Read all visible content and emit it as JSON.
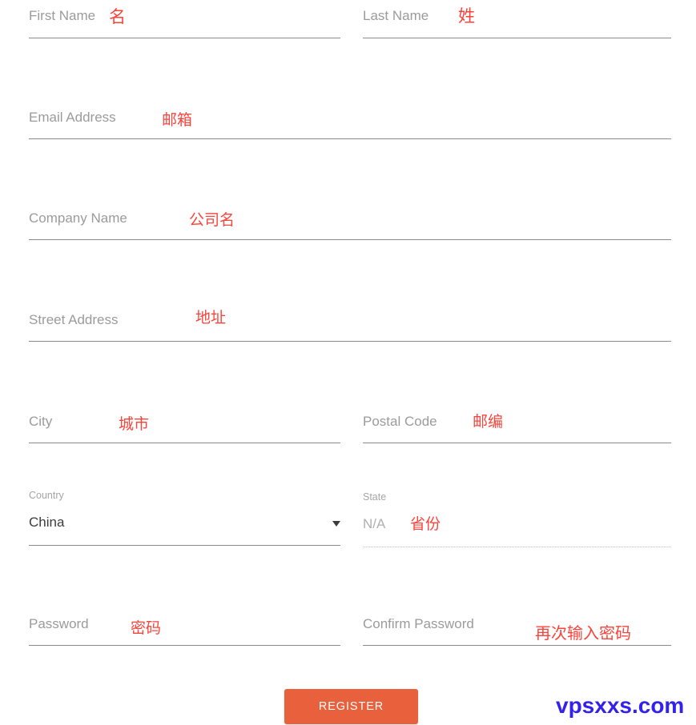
{
  "form": {
    "fields": [
      {
        "name": "first-name",
        "label": "First Name",
        "annotation": "名",
        "value": "",
        "placeholder": ""
      },
      {
        "name": "last-name",
        "label": "Last Name",
        "annotation": "姓",
        "value": "",
        "placeholder": ""
      },
      {
        "name": "email-address",
        "label": "Email Address",
        "annotation": "邮箱",
        "value": "",
        "placeholder": ""
      },
      {
        "name": "company-name",
        "label": "Company Name",
        "annotation": "公司名",
        "value": "",
        "placeholder": ""
      },
      {
        "name": "street-address",
        "label": "Street Address",
        "annotation": "地址",
        "value": "",
        "placeholder": ""
      },
      {
        "name": "city",
        "label": "City",
        "annotation": "城市",
        "value": "",
        "placeholder": ""
      },
      {
        "name": "postal-code",
        "label": "Postal Code",
        "annotation": "邮编",
        "value": "",
        "placeholder": ""
      },
      {
        "name": "country",
        "label": "Country",
        "annotation": "",
        "value": "China",
        "placeholder": ""
      },
      {
        "name": "state",
        "label": "State",
        "annotation": "省份",
        "value": "N/A",
        "placeholder": ""
      },
      {
        "name": "password",
        "label": "Password",
        "annotation": "密码",
        "value": "",
        "placeholder": ""
      },
      {
        "name": "confirm-password",
        "label": "Confirm Password",
        "annotation": "再次输入密码",
        "value": "",
        "placeholder": ""
      }
    ],
    "submit_label": "REGISTER"
  },
  "watermark": {
    "text": "vpsxxs.com"
  },
  "colors": {
    "accent": "#e8603c",
    "annotation": "#f9443c",
    "label": "#9b9b9b",
    "value": "#3c3c3c",
    "underline": "#8a8a8a",
    "watermark": "#3322ee"
  },
  "icons": {
    "country_dropdown": "chevron-down-icon"
  }
}
